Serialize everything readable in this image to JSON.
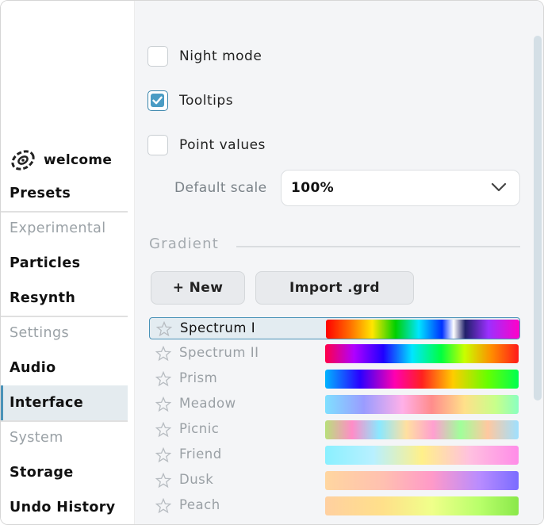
{
  "sidebar": {
    "welcome_label": "welcome",
    "items": [
      {
        "label": "Presets",
        "type": "item"
      },
      {
        "label": "Experimental",
        "type": "section"
      },
      {
        "label": "Particles",
        "type": "item"
      },
      {
        "label": "Resynth",
        "type": "item"
      },
      {
        "label": "Settings",
        "type": "section"
      },
      {
        "label": "Audio",
        "type": "item"
      },
      {
        "label": "Interface",
        "type": "item",
        "active": true
      },
      {
        "label": "System",
        "type": "section"
      },
      {
        "label": "Storage",
        "type": "item"
      },
      {
        "label": "Undo History",
        "type": "item"
      }
    ]
  },
  "settings": {
    "night_mode": {
      "label": "Night mode",
      "checked": false
    },
    "tooltips": {
      "label": "Tooltips",
      "checked": true
    },
    "point_values": {
      "label": "Point values",
      "checked": false
    },
    "default_scale_label": "Default scale",
    "default_scale_value": "100%"
  },
  "gradient": {
    "title": "Gradient",
    "new_button": "+ New",
    "import_button": "Import .grd",
    "items": [
      {
        "name": "Spectrum I",
        "selected": true
      },
      {
        "name": "Spectrum II"
      },
      {
        "name": "Prism"
      },
      {
        "name": "Meadow"
      },
      {
        "name": "Picnic"
      },
      {
        "name": "Friend"
      },
      {
        "name": "Dusk"
      },
      {
        "name": "Peach"
      }
    ]
  },
  "colors": {
    "accent": "#4a93b8",
    "checkbox_fill": "#4a9cc4"
  }
}
